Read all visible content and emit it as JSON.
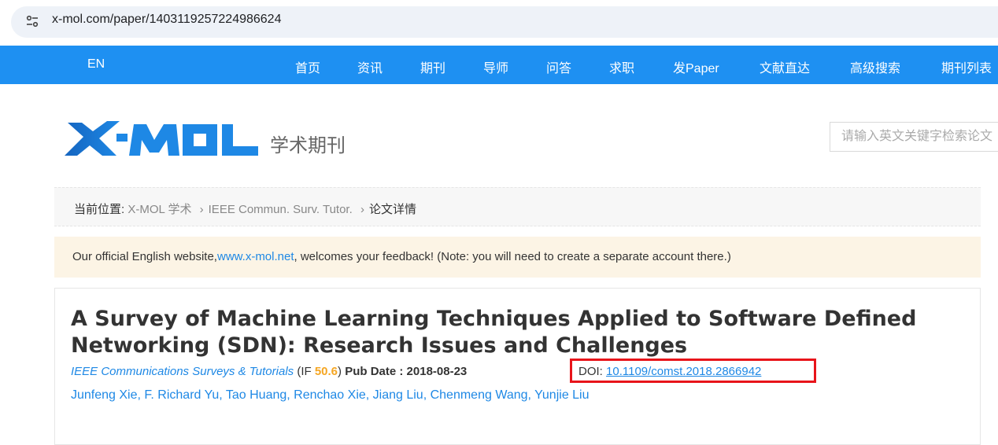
{
  "browser": {
    "url": "x-mol.com/paper/1403119257224986624",
    "site_icon": "site-settings-icon"
  },
  "nav": {
    "lang": "EN",
    "items": [
      "首页",
      "资讯",
      "期刊",
      "导师",
      "问答",
      "求职",
      "发Paper",
      "文献直达",
      "高级搜索",
      "期刊列表"
    ]
  },
  "header": {
    "logo": "X-MOL",
    "subtitle": "学术期刊",
    "search_placeholder": "请输入英文关键字检索论文"
  },
  "breadcrumb": {
    "prefix": "当前位置:",
    "items": [
      "X-MOL 学术",
      "IEEE Commun. Surv. Tutor.",
      "论文详情"
    ],
    "sep": "›"
  },
  "notice": {
    "before": "Our official English website,",
    "link": "www.x-mol.net",
    "after": ", welcomes your feedback! (Note: you will need to create a separate account there.)"
  },
  "paper": {
    "title": "A Survey of Machine Learning Techniques Applied to Software Defined Networking (SDN): Research Issues and Challenges",
    "journal": "IEEE Communications Surveys & Tutorials",
    "if_prefix": " (IF ",
    "if_value": "50.6",
    "if_suffix": ") ",
    "pub_date_label": "Pub Date : 2018-08-23",
    "doi_label": "DOI: ",
    "doi": "10.1109/comst.2018.2866942",
    "authors": "Junfeng Xie, F. Richard Yu, Tao Huang, Renchao Xie, Jiang Liu, Chenmeng Wang, Yunjie Liu"
  },
  "colors": {
    "nav_bg": "#1e90f2",
    "link": "#1e88e5",
    "highlight_box": "#e8141a",
    "if_value": "#f5a623",
    "notice_bg": "#fcf4e5"
  }
}
